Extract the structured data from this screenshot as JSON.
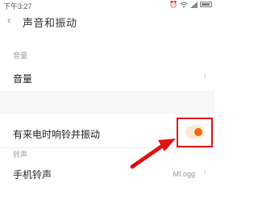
{
  "status_bar": {
    "time": "下午3:27",
    "icons": [
      "alarm-icon",
      "wifi-icon",
      "signal-icon",
      "battery-icon"
    ]
  },
  "header": {
    "title": "声音和振动",
    "back_icon": "chevron-left-icon"
  },
  "sections": {
    "volume": {
      "header": "音量",
      "row_label": "音量"
    },
    "vibrate": {
      "row_label": "有来电时响铃并振动",
      "toggle_on": true
    },
    "ringtone": {
      "header": "铃声",
      "row_label": "手机铃声",
      "value": "MI.ogg"
    }
  },
  "annotation": {
    "highlight_color": "#e11212",
    "accent_color": "#ef6c10"
  }
}
